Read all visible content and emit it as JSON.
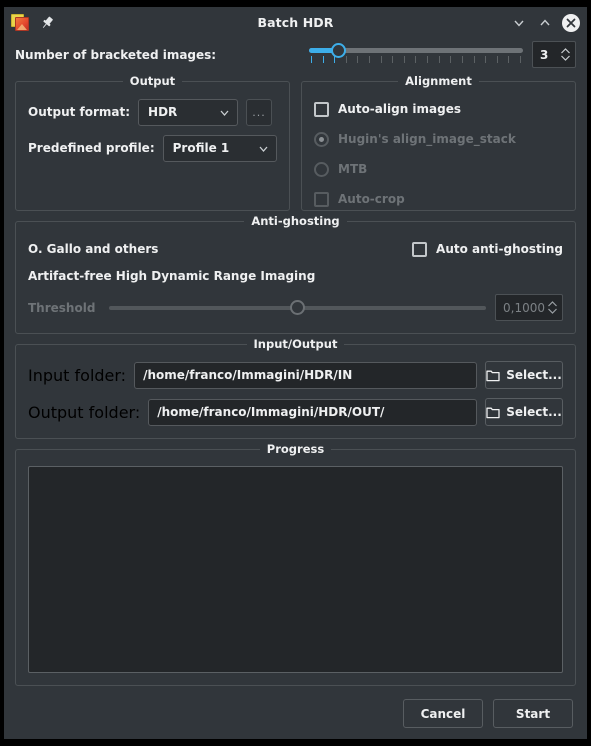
{
  "window": {
    "title": "Batch HDR",
    "app_icon": "luminance-hdr-icon",
    "pin_icon": "pin-icon",
    "controls": {
      "minimize": "chevron-down-icon",
      "maximize": "chevron-up-icon",
      "close": "close-circle-icon"
    }
  },
  "bracket": {
    "label": "Number of bracketed images:",
    "slider": {
      "value": 3,
      "min": 2,
      "max": 20,
      "fill_percent": 13,
      "tick_count": 19,
      "ticks_on": 3
    },
    "spin_value": "3"
  },
  "output": {
    "title": "Output",
    "format_label": "Output format:",
    "format_value": "HDR",
    "dots_button": "...",
    "profile_label": "Predefined profile:",
    "profile_value": "Profile 1"
  },
  "alignment": {
    "title": "Alignment",
    "auto_align": {
      "label": "Auto-align images",
      "checked": false,
      "enabled": true
    },
    "hugin": {
      "label": "Hugin's align_image_stack",
      "selected": true,
      "enabled": false
    },
    "mtb": {
      "label": "MTB",
      "selected": false,
      "enabled": false
    },
    "autocrop": {
      "label": "Auto-crop",
      "checked": false,
      "enabled": false
    }
  },
  "antighosting": {
    "title": "Anti-ghosting",
    "author": "O. Gallo and others",
    "paper": "Artifact-free High Dynamic Range Imaging",
    "auto": {
      "label": "Auto anti-ghosting",
      "checked": false
    },
    "threshold_label": "Threshold",
    "threshold_value": "0,1000",
    "threshold_percent": 48,
    "threshold_enabled": false
  },
  "inputoutput": {
    "title": "Input/Output",
    "input_label": "Input folder:",
    "input_value": "/home/franco/Immagini/HDR/IN",
    "input_select": "Select...",
    "output_label": "Output folder:",
    "output_value": "/home/franco/Immagini/HDR/OUT/",
    "output_select": "Select...",
    "folder_icon": "folder-icon"
  },
  "progress": {
    "title": "Progress",
    "log_text": ""
  },
  "footer": {
    "cancel": "Cancel",
    "start": "Start"
  },
  "colors": {
    "window_bg": "#31363b",
    "accent": "#3daee9",
    "field_bg": "#232629",
    "text": "#eff0f1",
    "disabled_text": "#6e7377",
    "border": "#4b5054"
  }
}
